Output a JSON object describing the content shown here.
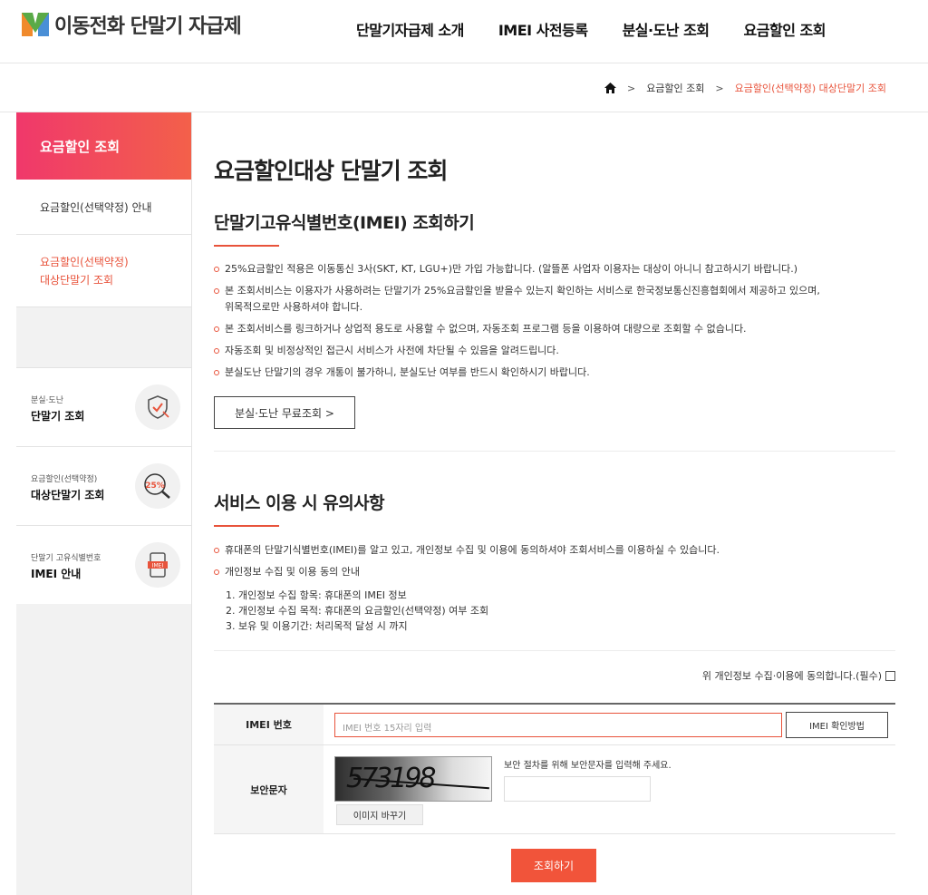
{
  "header": {
    "logo_text": "이동전화 단말기 자급제",
    "nav": [
      "단말기자급제 소개",
      "IMEI 사전등록",
      "분실·도난 조회",
      "요금할인 조회"
    ]
  },
  "breadcrumb": {
    "items": [
      "요금할인 조회",
      "요금할인(선택약정) 대상단말기 조회"
    ],
    "separator": ">"
  },
  "sidebar": {
    "heading": "요금할인 조회",
    "links": [
      "요금할인(선택약정) 안내",
      "요금할인(선택약정)",
      "대상단말기 조회"
    ],
    "quick": [
      {
        "small": "분실·도난",
        "big": "단말기 조회",
        "icon": "shield-check-icon"
      },
      {
        "small": "요금할인(선택약정)",
        "big": "대상단말기 조회",
        "icon": "magnifier-25-icon",
        "badge": "25%"
      },
      {
        "small": "단말기 고유식별번호",
        "big": "IMEI 안내",
        "icon": "phone-imei-icon",
        "badge": "IMEI"
      }
    ]
  },
  "main": {
    "title": "요금할인대상 단말기 조회",
    "section1": {
      "title": "단말기고유식별번호(IMEI) 조회하기",
      "bullets": [
        "25%요금할인 적용은 이동통신 3사(SKT, KT, LGU+)만 가입 가능합니다. (알뜰폰 사업자 이용자는 대상이 아니니 참고하시기 바랍니다.)",
        "본 조회서비스는 이용자가 사용하려는 단말기가 25%요금할인을 받을수 있는지 확인하는 서비스로 한국정보통신진흥협회에서 제공하고 있으며,",
        "위목적으로만 사용하셔야 합니다.",
        "본 조회서비스를 링크하거나 상업적 용도로 사용할 수 없으며, 자동조회 프로그램 등을 이용하여 대량으로 조회할 수 없습니다.",
        "자동조회 및 비정상적인 접근시 서비스가 사전에 차단될 수 있음을 알려드립니다.",
        "분실도난 단말기의 경우 개통이 불가하니, 분실도난 여부를 반드시 확인하시기 바랍니다."
      ],
      "button": "분실·도난 무료조회 >"
    },
    "section2": {
      "title": "서비스 이용 시 유의사항",
      "bullets": [
        "휴대폰의 단말기식별번호(IMEI)를 알고 있고, 개인정보 수집 및 이용에 동의하셔야 조회서비스를 이용하실 수 있습니다.",
        "개인정보 수집 및 이용 동의 안내"
      ],
      "numbered": [
        "1. 개인정보 수집 항목: 휴대폰의 IMEI 정보",
        "2. 개인정보 수집 목적: 휴대폰의 요금할인(선택약정) 여부 조회",
        "3. 보유 및 이용기간: 처리목적 달성 시 까지"
      ],
      "agree": "위 개인정보 수집·이용에 동의합니다.(필수)"
    },
    "form": {
      "imei_label": "IMEI 번호",
      "imei_placeholder": "IMEI 번호 15자리 입력",
      "imei_help_button": "IMEI 확인방법",
      "captcha_label": "보안문자",
      "captcha_text": "573198",
      "captcha_note": "보안 절차를 위해 보안문자를 입력해 주세요.",
      "refresh_button": "이미지 바꾸기",
      "submit": "조회하기"
    }
  },
  "colors": {
    "accent": "#e8533b",
    "sidebar_gradient_start": "#f0386b",
    "sidebar_gradient_end": "#f3604a"
  }
}
